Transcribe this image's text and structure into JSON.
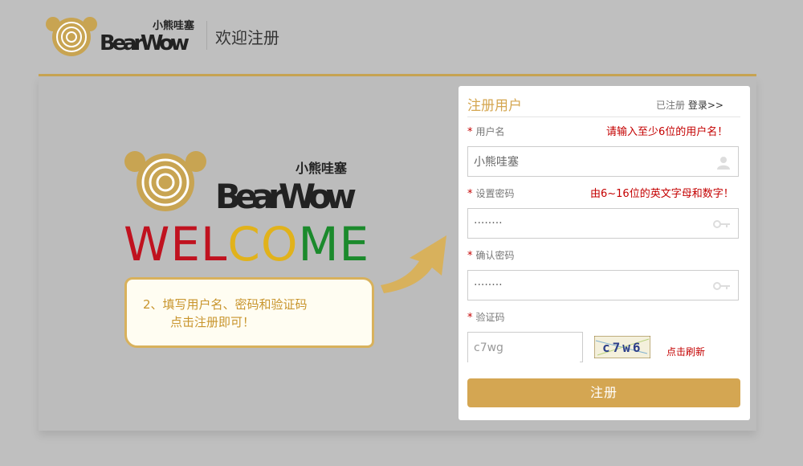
{
  "header": {
    "logo_cn": "小熊哇塞",
    "logo_en": "BearWow",
    "title": "欢迎注册"
  },
  "promo": {
    "logo_cn": "小熊哇塞",
    "logo_en": "BearWow",
    "welcome_letters": [
      {
        "ch": "W",
        "color": "#c0121f"
      },
      {
        "ch": "E",
        "color": "#c0121f"
      },
      {
        "ch": "L",
        "color": "#c0121f"
      },
      {
        "ch": "C",
        "color": "#e1b21b"
      },
      {
        "ch": "O",
        "color": "#e1b21b"
      },
      {
        "ch": "M",
        "color": "#1b8a2c"
      },
      {
        "ch": "E",
        "color": "#1b8a2c"
      }
    ],
    "note_line1": "2、填写用户名、密码和验证码",
    "note_line2": "点击注册即可！"
  },
  "form": {
    "title": "注册用户",
    "already_registered": "已注册",
    "login_link": "登录>>",
    "username": {
      "label": "用户名",
      "tip": "请输入至少6位的用户名！",
      "value": "小熊哇塞"
    },
    "password": {
      "label": "设置密码",
      "tip": "由6~16位的英文字母和数字！",
      "value": "········"
    },
    "confirm_password": {
      "label": "确认密码",
      "value": "········"
    },
    "captcha": {
      "label": "验证码",
      "value": "c7wg",
      "image_text": "c7w6",
      "refresh": "点击刷新"
    },
    "submit_label": "注册"
  },
  "colors": {
    "gold": "#d4a652",
    "red": "#c40000",
    "background": "#bfbfbf"
  },
  "icons": {
    "username": "user-icon",
    "password": "key-icon",
    "confirm": "key-icon"
  }
}
